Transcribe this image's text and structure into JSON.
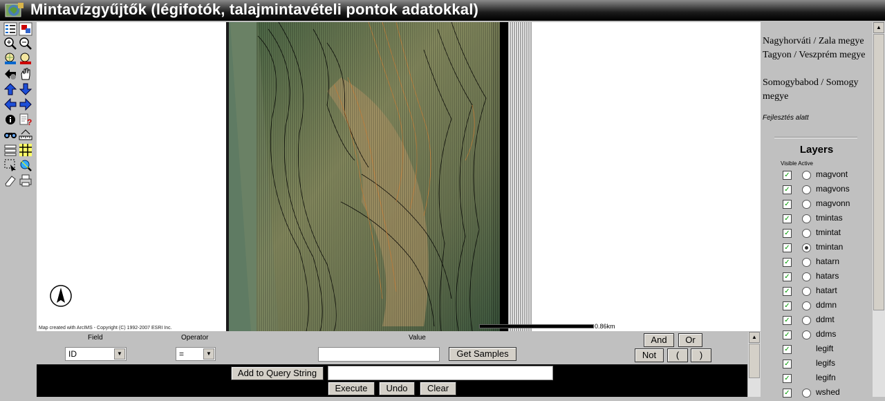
{
  "window": {
    "title": "Mintavízgyűjtők (légifotók, talajmintavételi pontok adatokkal)"
  },
  "toolbar": {
    "icons": [
      "legend-icon",
      "overview-icon",
      "zoom-in-icon",
      "zoom-out-icon",
      "zoom-full-icon",
      "zoom-active-icon",
      "back-icon",
      "pan-icon",
      "pan-up-icon",
      "pan-down-icon",
      "pan-left-icon",
      "pan-right-icon",
      "identify-icon",
      "query-icon",
      "find-icon",
      "measure-icon",
      "select-rect-icon",
      "buffer-icon",
      "select-icon",
      "zoom-selection-icon",
      "clear-icon",
      "print-icon"
    ]
  },
  "map": {
    "copyright": "Map created with ArcIMS - Copyright (C) 1992-2007 ESRI Inc.",
    "scale_label": "0.86km"
  },
  "sidebar": {
    "places": [
      "Nagyhorváti / Zala megye",
      "Tagyon / Veszprém megye",
      "Somogybabod / Somogy megye"
    ],
    "dev_note": "Fejlesztés alatt",
    "layers_title": "Layers",
    "visible_active": "Visible Active",
    "layers": [
      {
        "name": "magvont",
        "visible": true,
        "active": false,
        "has_radio": true
      },
      {
        "name": "magvons",
        "visible": true,
        "active": false,
        "has_radio": true
      },
      {
        "name": "magvonn",
        "visible": true,
        "active": false,
        "has_radio": true
      },
      {
        "name": "tmintas",
        "visible": true,
        "active": false,
        "has_radio": true
      },
      {
        "name": "tmintat",
        "visible": true,
        "active": false,
        "has_radio": true
      },
      {
        "name": "tmintan",
        "visible": true,
        "active": true,
        "has_radio": true
      },
      {
        "name": "hatarn",
        "visible": true,
        "active": false,
        "has_radio": true
      },
      {
        "name": "hatars",
        "visible": true,
        "active": false,
        "has_radio": true
      },
      {
        "name": "hatart",
        "visible": true,
        "active": false,
        "has_radio": true
      },
      {
        "name": "ddmn",
        "visible": true,
        "active": false,
        "has_radio": true
      },
      {
        "name": "ddmt",
        "visible": true,
        "active": false,
        "has_radio": true
      },
      {
        "name": "ddms",
        "visible": true,
        "active": false,
        "has_radio": true
      },
      {
        "name": "legift",
        "visible": true,
        "active": false,
        "has_radio": false
      },
      {
        "name": "legifs",
        "visible": true,
        "active": false,
        "has_radio": false
      },
      {
        "name": "legifn",
        "visible": true,
        "active": false,
        "has_radio": false
      },
      {
        "name": "wshed",
        "visible": true,
        "active": false,
        "has_radio": true
      }
    ]
  },
  "query": {
    "field_label": "Field",
    "operator_label": "Operator",
    "value_label": "Value",
    "field_value": "ID",
    "operator_value": "=",
    "value_input": "",
    "get_samples": "Get Samples",
    "and": "And",
    "or": "Or",
    "not": "Not",
    "open_paren": "(",
    "close_paren": ")",
    "add_to_query": "Add to Query String",
    "query_string": "",
    "execute": "Execute",
    "undo": "Undo",
    "clear": "Clear"
  }
}
